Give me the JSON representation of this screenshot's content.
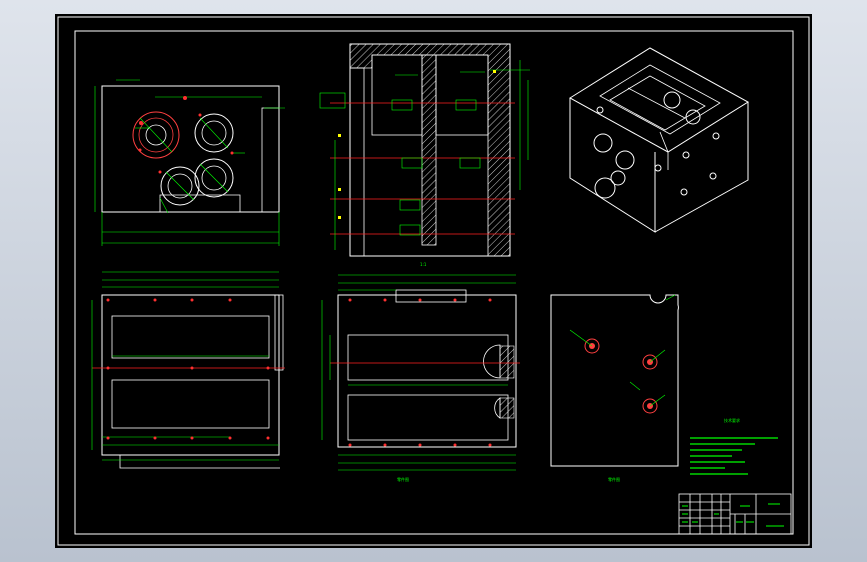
{
  "drawing": {
    "sheet_label": "零件图",
    "scale_label": "1:1",
    "notes_title": "技术要求",
    "notes_lines": [
      "",
      "",
      "",
      "",
      "",
      "",
      ""
    ],
    "title_block": {
      "part_name": "",
      "drawing_name": ""
    },
    "colors": {
      "background": "#000000",
      "outline": "#ffffff",
      "dimension": "#00ff00",
      "center_line": "#ff2020",
      "hatch": "#ffffff",
      "hole": "#ff3030"
    }
  }
}
